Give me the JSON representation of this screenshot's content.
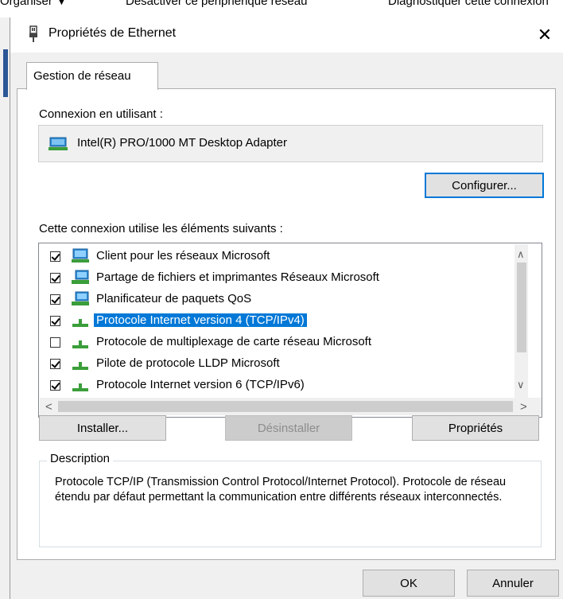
{
  "background_window": {
    "menu_items": [
      "Organiser ▼",
      "Désactiver ce périphérique réseau",
      "Diagnostiquer cette connexion"
    ]
  },
  "dialog": {
    "title": "Propriétés de Ethernet",
    "close_symbol": "✕",
    "tab_label": "Gestion de réseau",
    "connection_label": "Connexion en utilisant :",
    "adapter_name": "Intel(R) PRO/1000 MT Desktop Adapter",
    "configure_button": "Configurer...",
    "components_label": "Cette connexion utilise les éléments suivants :",
    "components": [
      {
        "label": "Client pour les réseaux Microsoft",
        "checked": true,
        "icon": "network-client-icon",
        "selected": false
      },
      {
        "label": "Partage de fichiers et imprimantes Réseaux Microsoft",
        "checked": true,
        "icon": "network-service-icon",
        "selected": false
      },
      {
        "label": "Planificateur de paquets QoS",
        "checked": true,
        "icon": "network-service-icon",
        "selected": false
      },
      {
        "label": "Protocole Internet version 4 (TCP/IPv4)",
        "checked": true,
        "icon": "protocol-icon",
        "selected": true
      },
      {
        "label": "Protocole de multiplexage de carte réseau Microsoft",
        "checked": false,
        "icon": "protocol-icon",
        "selected": false
      },
      {
        "label": "Pilote de protocole LLDP Microsoft",
        "checked": true,
        "icon": "protocol-icon",
        "selected": false
      },
      {
        "label": "Protocole Internet version 6 (TCP/IPv6)",
        "checked": true,
        "icon": "protocol-icon",
        "selected": false
      }
    ],
    "install_button": "Installer...",
    "uninstall_button": "Désinstaller",
    "properties_button": "Propriétés",
    "description_legend": "Description",
    "description_text": "Protocole TCP/IP (Transmission Control Protocol/Internet Protocol). Protocole de réseau étendu par défaut permettant la communication entre différents réseaux interconnectés.",
    "ok_button": "OK",
    "cancel_button": "Annuler"
  },
  "colors": {
    "selection": "#0078d7",
    "window_bg": "#f0f0f0",
    "panel_bg": "#ffffff"
  }
}
